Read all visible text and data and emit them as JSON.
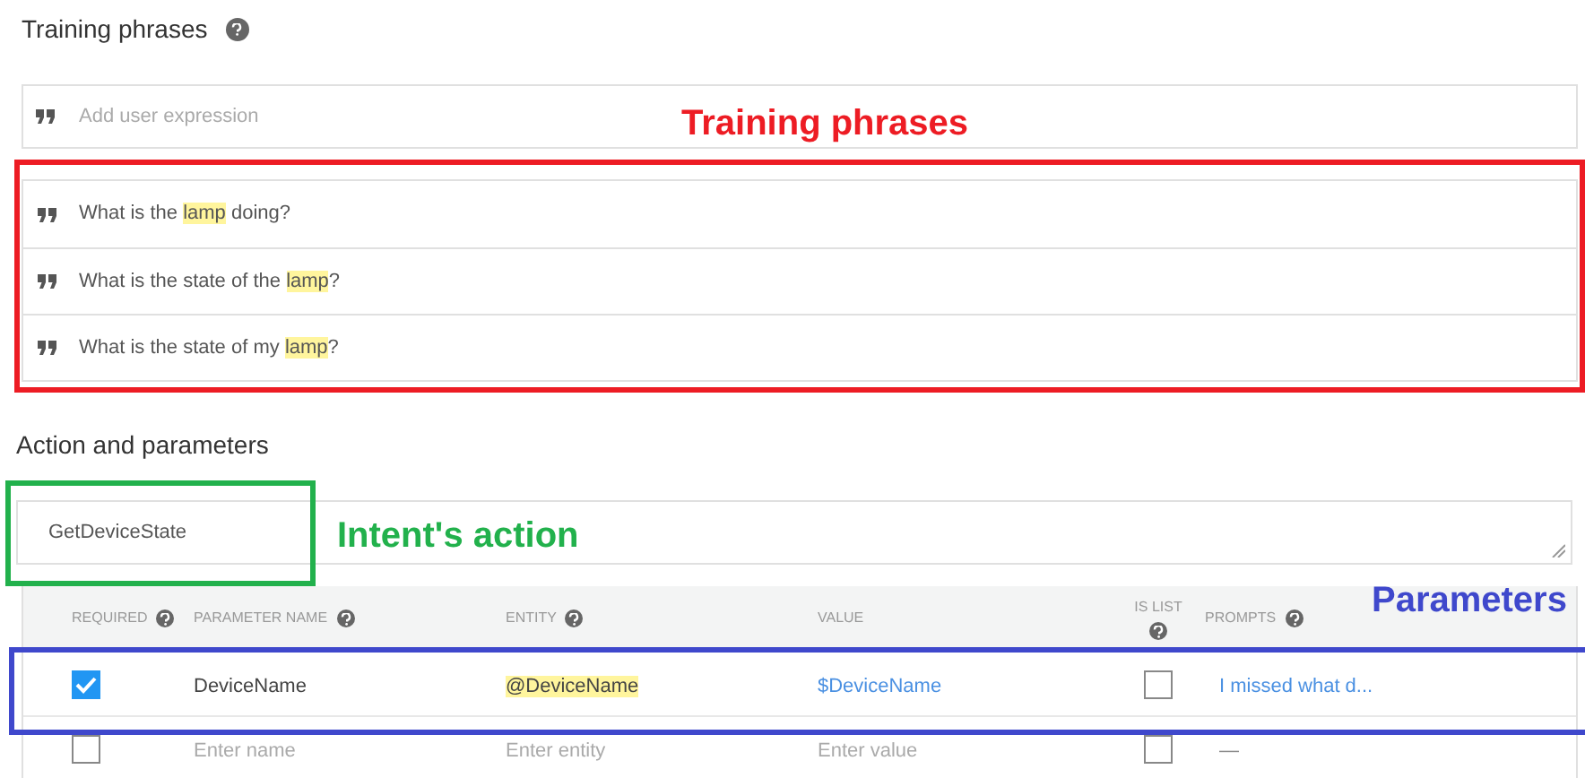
{
  "training_phrases": {
    "title": "Training phrases",
    "placeholder": "Add user expression",
    "annotation": {
      "label": "Training phrases",
      "color": "#ed1c24"
    },
    "phrases": [
      [
        {
          "text": "What is the "
        },
        {
          "text": "lamp",
          "highlighted": true
        },
        {
          "text": " doing?"
        }
      ],
      [
        {
          "text": "What is the state of the "
        },
        {
          "text": "lamp",
          "highlighted": true
        },
        {
          "text": "?"
        }
      ],
      [
        {
          "text": "What is the state of my "
        },
        {
          "text": "lamp",
          "highlighted": true
        },
        {
          "text": "?"
        }
      ]
    ]
  },
  "action": {
    "title": "Action and parameters",
    "value": "GetDeviceState",
    "annotation": {
      "label": "Intent's action",
      "color": "#22b14c"
    }
  },
  "parameters": {
    "annotation": {
      "label": "Parameters",
      "color": "#3f48cc"
    },
    "columns": [
      {
        "label": "REQUIRED",
        "help": true
      },
      {
        "label": "PARAMETER NAME",
        "help": true
      },
      {
        "label": "ENTITY",
        "help": true
      },
      {
        "label": "VALUE",
        "help": false
      },
      {
        "label": "IS LIST",
        "help": true
      },
      {
        "label": "PROMPTS",
        "help": true
      }
    ],
    "rows": [
      {
        "kind": "filled",
        "required": true,
        "name": "DeviceName",
        "entity": "@DeviceName",
        "entity_highlighted": true,
        "value": "$DeviceName",
        "is_list": false,
        "prompts": "I missed what d..."
      },
      {
        "kind": "empty",
        "required": false,
        "name": "Enter name",
        "entity": "Enter entity",
        "entity_highlighted": false,
        "value": "Enter value",
        "is_list": false,
        "prompts": "—"
      }
    ]
  }
}
